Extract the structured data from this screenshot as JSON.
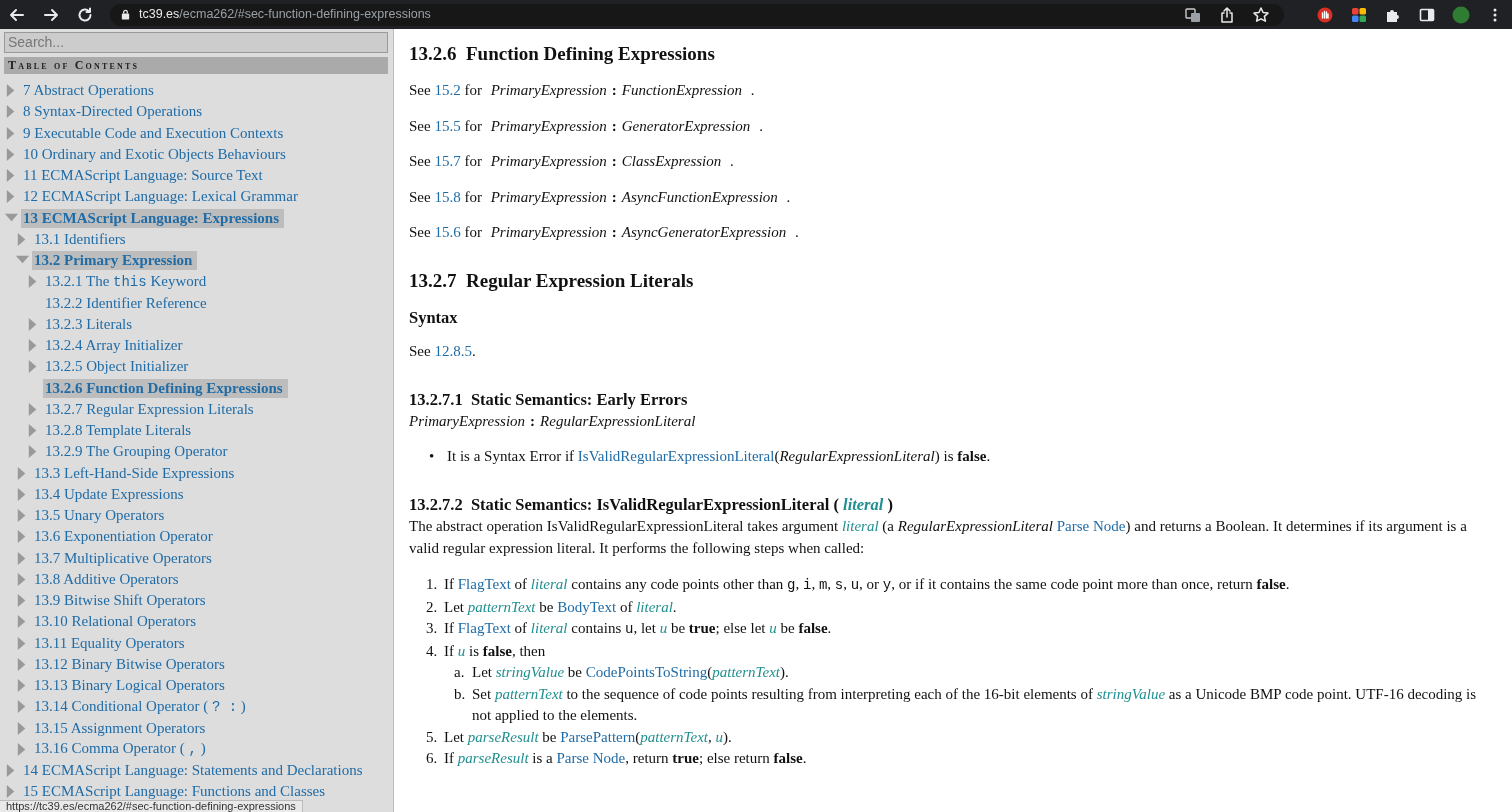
{
  "browser": {
    "url_host": "tc39.es",
    "url_path": "/ecma262/#sec-function-defining-expressions"
  },
  "sidebar": {
    "search": {
      "placeholder": "Search..."
    },
    "toc_title": "Table of Contents",
    "items": [
      {
        "label": "7 Abstract Operations",
        "kind": "branch",
        "expanded": false,
        "selected": false
      },
      {
        "label": "8 Syntax-Directed Operations",
        "kind": "branch",
        "expanded": false,
        "selected": false
      },
      {
        "label": "9 Executable Code and Execution Contexts",
        "kind": "branch",
        "expanded": false,
        "selected": false
      },
      {
        "label": "10 Ordinary and Exotic Objects Behaviours",
        "kind": "branch",
        "expanded": false,
        "selected": false
      },
      {
        "label": "11 ECMAScript Language: Source Text",
        "kind": "branch",
        "expanded": false,
        "selected": false
      },
      {
        "label": "12 ECMAScript Language: Lexical Grammar",
        "kind": "branch",
        "expanded": false,
        "selected": false
      },
      {
        "label": "13 ECMAScript Language: Expressions",
        "kind": "branch",
        "expanded": true,
        "selected": true,
        "children": [
          {
            "label": "13.1 Identifiers",
            "kind": "branch",
            "expanded": false,
            "selected": false
          },
          {
            "label": "13.2 Primary Expression",
            "kind": "branch",
            "expanded": true,
            "selected": true,
            "children": [
              {
                "parts": [
                  {
                    "kind": "text",
                    "text": "13.2.1 The "
                  },
                  {
                    "kind": "code",
                    "text": "this"
                  },
                  {
                    "kind": "text",
                    "text": " Keyword"
                  }
                ],
                "kind": "branch",
                "expanded": false,
                "selected": false
              },
              {
                "label": "13.2.2 Identifier Reference",
                "kind": "leaf",
                "selected": false
              },
              {
                "label": "13.2.3 Literals",
                "kind": "branch",
                "expanded": false,
                "selected": false
              },
              {
                "label": "13.2.4 Array Initializer",
                "kind": "branch",
                "expanded": false,
                "selected": false
              },
              {
                "label": "13.2.5 Object Initializer",
                "kind": "branch",
                "expanded": false,
                "selected": false
              },
              {
                "label": "13.2.6 Function Defining Expressions",
                "kind": "leaf",
                "selected": true
              },
              {
                "label": "13.2.7 Regular Expression Literals",
                "kind": "branch",
                "expanded": false,
                "selected": false
              },
              {
                "label": "13.2.8 Template Literals",
                "kind": "branch",
                "expanded": false,
                "selected": false
              },
              {
                "label": "13.2.9 The Grouping Operator",
                "kind": "branch",
                "expanded": false,
                "selected": false
              }
            ]
          },
          {
            "label": "13.3 Left-Hand-Side Expressions",
            "kind": "branch",
            "expanded": false,
            "selected": false
          },
          {
            "label": "13.4 Update Expressions",
            "kind": "branch",
            "expanded": false,
            "selected": false
          },
          {
            "label": "13.5 Unary Operators",
            "kind": "branch",
            "expanded": false,
            "selected": false
          },
          {
            "label": "13.6 Exponentiation Operator",
            "kind": "branch",
            "expanded": false,
            "selected": false
          },
          {
            "label": "13.7 Multiplicative Operators",
            "kind": "branch",
            "expanded": false,
            "selected": false
          },
          {
            "label": "13.8 Additive Operators",
            "kind": "branch",
            "expanded": false,
            "selected": false
          },
          {
            "label": "13.9 Bitwise Shift Operators",
            "kind": "branch",
            "expanded": false,
            "selected": false
          },
          {
            "label": "13.10 Relational Operators",
            "kind": "branch",
            "expanded": false,
            "selected": false
          },
          {
            "label": "13.11 Equality Operators",
            "kind": "branch",
            "expanded": false,
            "selected": false
          },
          {
            "label": "13.12 Binary Bitwise Operators",
            "kind": "branch",
            "expanded": false,
            "selected": false
          },
          {
            "label": "13.13 Binary Logical Operators",
            "kind": "branch",
            "expanded": false,
            "selected": false
          },
          {
            "parts": [
              {
                "kind": "text",
                "text": "13.14 Conditional Operator ( "
              },
              {
                "kind": "code",
                "text": "? :"
              },
              {
                "kind": "text",
                "text": " )"
              }
            ],
            "kind": "branch",
            "expanded": false,
            "selected": false
          },
          {
            "label": "13.15 Assignment Operators",
            "kind": "branch",
            "expanded": false,
            "selected": false
          },
          {
            "parts": [
              {
                "kind": "text",
                "text": "13.16 Comma Operator ( "
              },
              {
                "kind": "code",
                "text": ","
              },
              {
                "kind": "text",
                "text": " )"
              }
            ],
            "kind": "branch",
            "expanded": false,
            "selected": false
          }
        ]
      },
      {
        "label": "14 ECMAScript Language: Statements and Declarations",
        "kind": "branch",
        "expanded": false,
        "selected": false
      },
      {
        "label": "15 ECMAScript Language: Functions and Classes",
        "kind": "branch",
        "expanded": false,
        "selected": false
      }
    ]
  },
  "content": [
    {
      "kind": "section_heading",
      "number": "13.2.6",
      "title": [
        {
          "kind": "text",
          "text": "Function Defining Expressions"
        }
      ]
    },
    {
      "kind": "see",
      "segments": [
        {
          "kind": "text",
          "text": "See "
        },
        {
          "kind": "link",
          "text": "15.2"
        },
        {
          "kind": "text",
          "text": " for "
        },
        {
          "kind": "gnt",
          "text": "PrimaryExpression"
        },
        {
          "kind": "sym",
          "text": ":"
        },
        {
          "kind": "gnt",
          "text": "FunctionExpression"
        },
        {
          "kind": "text",
          "text": " ."
        }
      ]
    },
    {
      "kind": "see",
      "segments": [
        {
          "kind": "text",
          "text": "See "
        },
        {
          "kind": "link",
          "text": "15.5"
        },
        {
          "kind": "text",
          "text": " for "
        },
        {
          "kind": "gnt",
          "text": "PrimaryExpression"
        },
        {
          "kind": "sym",
          "text": ":"
        },
        {
          "kind": "gnt",
          "text": "GeneratorExpression"
        },
        {
          "kind": "text",
          "text": " ."
        }
      ]
    },
    {
      "kind": "see",
      "segments": [
        {
          "kind": "text",
          "text": "See "
        },
        {
          "kind": "link",
          "text": "15.7"
        },
        {
          "kind": "text",
          "text": " for "
        },
        {
          "kind": "gnt",
          "text": "PrimaryExpression"
        },
        {
          "kind": "sym",
          "text": ":"
        },
        {
          "kind": "gnt",
          "text": "ClassExpression"
        },
        {
          "kind": "text",
          "text": " ."
        }
      ]
    },
    {
      "kind": "see",
      "segments": [
        {
          "kind": "text",
          "text": "See "
        },
        {
          "kind": "link",
          "text": "15.8"
        },
        {
          "kind": "text",
          "text": " for "
        },
        {
          "kind": "gnt",
          "text": "PrimaryExpression"
        },
        {
          "kind": "sym",
          "text": ":"
        },
        {
          "kind": "gnt",
          "text": "AsyncFunctionExpression"
        },
        {
          "kind": "text",
          "text": " ."
        }
      ]
    },
    {
      "kind": "see",
      "segments": [
        {
          "kind": "text",
          "text": "See "
        },
        {
          "kind": "link",
          "text": "15.6"
        },
        {
          "kind": "text",
          "text": " for "
        },
        {
          "kind": "gnt",
          "text": "PrimaryExpression"
        },
        {
          "kind": "sym",
          "text": ":"
        },
        {
          "kind": "gnt",
          "text": "AsyncGeneratorExpression"
        },
        {
          "kind": "text",
          "text": " ."
        }
      ]
    },
    {
      "kind": "section_heading",
      "number": "13.2.7",
      "title": [
        {
          "kind": "text",
          "text": "Regular Expression Literals"
        }
      ]
    },
    {
      "kind": "subheading",
      "title": [
        {
          "kind": "text",
          "text": "Syntax"
        }
      ]
    },
    {
      "kind": "para",
      "segments": [
        {
          "kind": "text",
          "text": "See "
        },
        {
          "kind": "link",
          "text": "12.8.5"
        },
        {
          "kind": "text",
          "text": "."
        }
      ]
    },
    {
      "kind": "clause_heading",
      "number": "13.2.7.1",
      "title": [
        {
          "kind": "text",
          "text": "Static Semantics: Early Errors"
        }
      ]
    },
    {
      "kind": "production",
      "segments": [
        {
          "kind": "gnt",
          "text": "PrimaryExpression"
        },
        {
          "kind": "sym",
          "text": ":"
        },
        {
          "kind": "gnt",
          "text": "RegularExpressionLiteral"
        }
      ]
    },
    {
      "kind": "bullets",
      "items": [
        {
          "marker": "•",
          "segments": [
            {
              "kind": "text",
              "text": "It is a Syntax Error if "
            },
            {
              "kind": "link",
              "text": "IsValidRegularExpressionLiteral"
            },
            {
              "kind": "text",
              "text": "("
            },
            {
              "kind": "nt",
              "text": "RegularExpressionLiteral"
            },
            {
              "kind": "text",
              "text": ") is "
            },
            {
              "kind": "bold",
              "text": "false"
            },
            {
              "kind": "text",
              "text": "."
            }
          ]
        }
      ]
    },
    {
      "kind": "clause_heading",
      "number": "13.2.7.2",
      "title": [
        {
          "kind": "text",
          "text": "Static Semantics: IsValidRegularExpressionLiteral ( "
        },
        {
          "kind": "var",
          "text": "literal"
        },
        {
          "kind": "text",
          "text": " )"
        }
      ]
    },
    {
      "kind": "para",
      "segments": [
        {
          "kind": "text",
          "text": "The abstract operation IsValidRegularExpressionLiteral takes argument "
        },
        {
          "kind": "var",
          "text": "literal"
        },
        {
          "kind": "text",
          "text": " (a "
        },
        {
          "kind": "nt",
          "text": "RegularExpressionLiteral "
        },
        {
          "kind": "link",
          "text": "Parse Node"
        },
        {
          "kind": "text",
          "text": ") and returns a Boolean. It determines if its argument is a valid regular expression literal. It performs the following steps when called:"
        }
      ]
    },
    {
      "kind": "steps",
      "items": [
        {
          "marker": "1.",
          "segments": [
            {
              "kind": "text",
              "text": "If "
            },
            {
              "kind": "link",
              "text": "FlagText"
            },
            {
              "kind": "text",
              "text": " of "
            },
            {
              "kind": "var",
              "text": "literal"
            },
            {
              "kind": "text",
              "text": " contains any code points other than "
            },
            {
              "kind": "code",
              "text": "g"
            },
            {
              "kind": "text",
              "text": ", "
            },
            {
              "kind": "code",
              "text": "i"
            },
            {
              "kind": "text",
              "text": ", "
            },
            {
              "kind": "code",
              "text": "m"
            },
            {
              "kind": "text",
              "text": ", "
            },
            {
              "kind": "code",
              "text": "s"
            },
            {
              "kind": "text",
              "text": ", "
            },
            {
              "kind": "code",
              "text": "u"
            },
            {
              "kind": "text",
              "text": ", or "
            },
            {
              "kind": "code",
              "text": "y"
            },
            {
              "kind": "text",
              "text": ", or if it contains the same code point more than once, return "
            },
            {
              "kind": "bold",
              "text": "false"
            },
            {
              "kind": "text",
              "text": "."
            }
          ]
        },
        {
          "marker": "2.",
          "segments": [
            {
              "kind": "text",
              "text": "Let "
            },
            {
              "kind": "var",
              "text": "patternText"
            },
            {
              "kind": "text",
              "text": " be "
            },
            {
              "kind": "link",
              "text": "BodyText"
            },
            {
              "kind": "text",
              "text": " of "
            },
            {
              "kind": "var",
              "text": "literal"
            },
            {
              "kind": "text",
              "text": "."
            }
          ]
        },
        {
          "marker": "3.",
          "segments": [
            {
              "kind": "text",
              "text": "If "
            },
            {
              "kind": "link",
              "text": "FlagText"
            },
            {
              "kind": "text",
              "text": " of "
            },
            {
              "kind": "var",
              "text": "literal"
            },
            {
              "kind": "text",
              "text": " contains "
            },
            {
              "kind": "code",
              "text": "u"
            },
            {
              "kind": "text",
              "text": ", let "
            },
            {
              "kind": "var",
              "text": "u"
            },
            {
              "kind": "text",
              "text": " be "
            },
            {
              "kind": "bold",
              "text": "true"
            },
            {
              "kind": "text",
              "text": "; else let "
            },
            {
              "kind": "var",
              "text": "u"
            },
            {
              "kind": "text",
              "text": " be "
            },
            {
              "kind": "bold",
              "text": "false"
            },
            {
              "kind": "text",
              "text": "."
            }
          ]
        },
        {
          "marker": "4.",
          "segments": [
            {
              "kind": "text",
              "text": "If "
            },
            {
              "kind": "var",
              "text": "u"
            },
            {
              "kind": "text",
              "text": " is "
            },
            {
              "kind": "bold",
              "text": "false"
            },
            {
              "kind": "text",
              "text": ", then"
            }
          ],
          "children": [
            {
              "marker": "a.",
              "segments": [
                {
                  "kind": "text",
                  "text": "Let "
                },
                {
                  "kind": "var",
                  "text": "stringValue"
                },
                {
                  "kind": "text",
                  "text": " be "
                },
                {
                  "kind": "link",
                  "text": "CodePointsToString"
                },
                {
                  "kind": "text",
                  "text": "("
                },
                {
                  "kind": "var",
                  "text": "patternText"
                },
                {
                  "kind": "text",
                  "text": ")."
                }
              ]
            },
            {
              "marker": "b.",
              "segments": [
                {
                  "kind": "text",
                  "text": "Set "
                },
                {
                  "kind": "var",
                  "text": "patternText"
                },
                {
                  "kind": "text",
                  "text": " to the sequence of code points resulting from interpreting each of the 16-bit elements of "
                },
                {
                  "kind": "var",
                  "text": "stringValue"
                },
                {
                  "kind": "text",
                  "text": " as a Unicode BMP code point. UTF-16 decoding is not applied to the elements."
                }
              ]
            }
          ]
        },
        {
          "marker": "5.",
          "segments": [
            {
              "kind": "text",
              "text": "Let "
            },
            {
              "kind": "var",
              "text": "parseResult"
            },
            {
              "kind": "text",
              "text": " be "
            },
            {
              "kind": "link",
              "text": "ParsePattern"
            },
            {
              "kind": "text",
              "text": "("
            },
            {
              "kind": "var",
              "text": "patternText"
            },
            {
              "kind": "text",
              "text": ", "
            },
            {
              "kind": "var",
              "text": "u"
            },
            {
              "kind": "text",
              "text": ")."
            }
          ]
        },
        {
          "marker": "6.",
          "segments": [
            {
              "kind": "text",
              "text": "If "
            },
            {
              "kind": "var",
              "text": "parseResult"
            },
            {
              "kind": "text",
              "text": " is a "
            },
            {
              "kind": "link",
              "text": "Parse Node"
            },
            {
              "kind": "text",
              "text": ", return "
            },
            {
              "kind": "bold",
              "text": "true"
            },
            {
              "kind": "text",
              "text": "; else return "
            },
            {
              "kind": "bold",
              "text": "false"
            },
            {
              "kind": "text",
              "text": "."
            }
          ]
        }
      ]
    }
  ],
  "status_bar": {
    "url": "https://tc39.es/ecma262/#sec-function-defining-expressions"
  }
}
